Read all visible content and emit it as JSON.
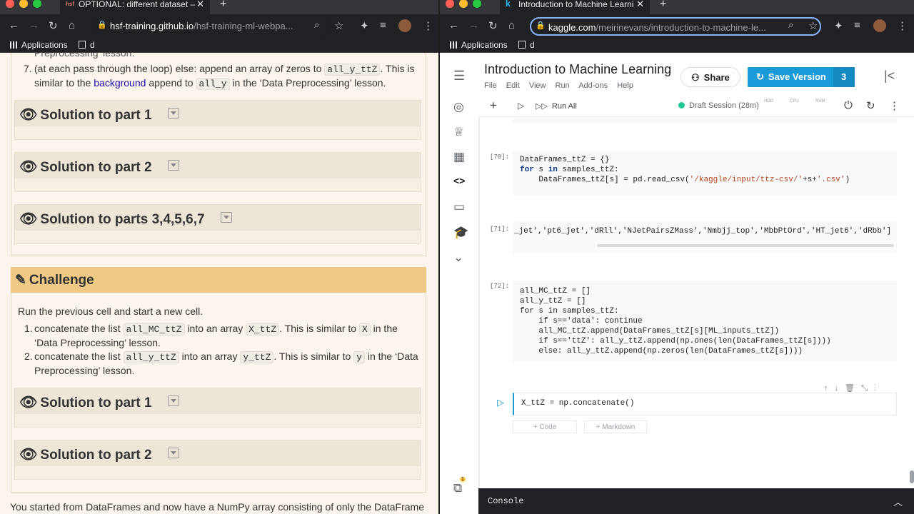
{
  "left": {
    "tab_title": "OPTIONAL: different dataset –",
    "url_host": "hsf-training.github.io",
    "url_path": "/hsf-training-ml-webpa...",
    "bookmarks": {
      "apps": "Applications",
      "d": "d"
    },
    "partial_top": "Preprocessing’ lesson.",
    "item7": {
      "num": "7.",
      "pre": "(at each pass through the loop) else: append an array of zeros to",
      "code1": "all_y_ttZ",
      "mid": ". This is similar to the",
      "link": "background",
      "mid2": "append to",
      "code2": "all_y",
      "post": "in the ‘Data Preprocessing’ lesson."
    },
    "solutions_top": [
      "Solution to part 1",
      "Solution to part 2",
      "Solution to parts 3,4,5,6,7"
    ],
    "challenge_title": "Challenge",
    "challenge_intro": "Run the previous cell and start a new cell.",
    "challenge_items": [
      {
        "num": "1.",
        "pre": "concatenate the list",
        "code1": "all_MC_ttZ",
        "mid": "into an array",
        "code2": "X_ttZ",
        "mid2": ". This is similar to",
        "code3": "X",
        "post": "in the ‘Data Preprocessing’ lesson."
      },
      {
        "num": "2.",
        "pre": "concatenate the list",
        "code1": "all_y_ttZ",
        "mid": "into an array",
        "code2": "y_ttZ",
        "mid2": ". This is similar to",
        "code3": "y",
        "post": "in the ‘Data Preprocessing’ lesson."
      }
    ],
    "solutions_bottom": [
      "Solution to part 1",
      "Solution to part 2"
    ],
    "footer_text": "You started from DataFrames and now have a NumPy array consisting of only the DataFrame"
  },
  "right": {
    "tab_title": "Introduction to Machine Learni",
    "url_host": "kaggle.com",
    "url_path": "/meirinevans/introduction-to-machine-le...",
    "bookmarks": {
      "apps": "Applications",
      "d": "d"
    },
    "notebook_title": "Introduction to Machine Learning",
    "menu": [
      "File",
      "Edit",
      "View",
      "Run",
      "Add-ons",
      "Help"
    ],
    "share": "Share",
    "save_version": "Save Version",
    "version_count": "3",
    "run_all": "Run All",
    "session": "Draft Session (28m)",
    "meters": [
      "HDD",
      "CPU",
      "RAM"
    ],
    "cells": [
      {
        "prompt": "[70]:"
      },
      {
        "prompt": "[71]:",
        "code": "_jet','pt6_jet','dRll','NJetPairsZMass','Nmbjj_top','MbbPtOrd','HT_jet6','dRbb']"
      },
      {
        "prompt": "[72]:"
      }
    ],
    "cell70": {
      "l1": "DataFrames_ttZ = {}",
      "for": "for",
      "in": "in",
      "l2b": " s ",
      "l2c": " samples_ttZ:",
      "l3a": "    DataFrames_ttZ[s] = pd.read_csv(",
      "l3s": "'/kaggle/input/ttz-csv/'",
      "l3b": "+s+",
      "l3s2": "'.csv'",
      "l3c": ")"
    },
    "cell72": {
      "l1": "all_MC_ttZ = []",
      "l2": "all_y_ttZ = []",
      "l3": "for s in samples_ttZ:",
      "l4": "    if s=='data': continue",
      "l5": "    all_MC_ttZ.append(DataFrames_ttZ[s][ML_inputs_ttZ])",
      "l6": "    if s=='ttZ': all_y_ttZ.append(np.ones(len(DataFrames_ttZ[s])))",
      "l7": "    else: all_y_ttZ.append(np.zeros(len(DataFrames_ttZ[s])))"
    },
    "active_cell_code": "X_ttZ = np.concatenate()",
    "add_code": "+ Code",
    "add_markdown": "+ Markdown",
    "console": "Console",
    "notification_count": "1"
  },
  "colors": {
    "challenge": "#f0c987",
    "solution_head": "#ede6d6",
    "kaggle_blue": "#1a9ad6",
    "chrome_dark": "#202124"
  }
}
